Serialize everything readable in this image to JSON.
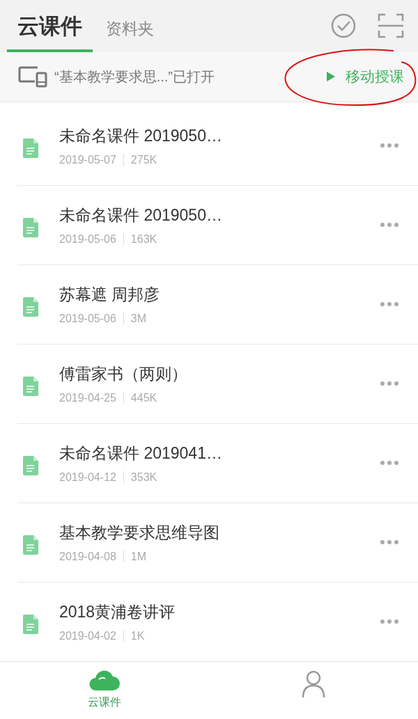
{
  "tabs": [
    {
      "label": "云课件",
      "selected": true
    },
    {
      "label": "资料夹",
      "selected": false
    }
  ],
  "banner": {
    "message": "“基本教学要求思...”已打开",
    "action": "移动授课",
    "annotated": true
  },
  "files": [
    {
      "title": "未命名课件 2019050…",
      "date": "2019-05-07",
      "size": "275K"
    },
    {
      "title": "未命名课件 2019050…",
      "date": "2019-05-06",
      "size": "163K"
    },
    {
      "title": "苏幕遮 周邦彦",
      "date": "2019-05-06",
      "size": "3M"
    },
    {
      "title": "傅雷家书（两则）",
      "date": "2019-04-25",
      "size": "445K"
    },
    {
      "title": "未命名课件 2019041…",
      "date": "2019-04-12",
      "size": "353K"
    },
    {
      "title": "基本教学要求思维导图",
      "date": "2019-04-08",
      "size": "1M"
    },
    {
      "title": "2018黄浦卷讲评",
      "date": "2019-04-02",
      "size": "1K"
    }
  ],
  "bottom_nav": [
    {
      "kind": "cloud",
      "label": "云课件",
      "selected": true
    },
    {
      "kind": "person",
      "selected": false
    }
  ]
}
